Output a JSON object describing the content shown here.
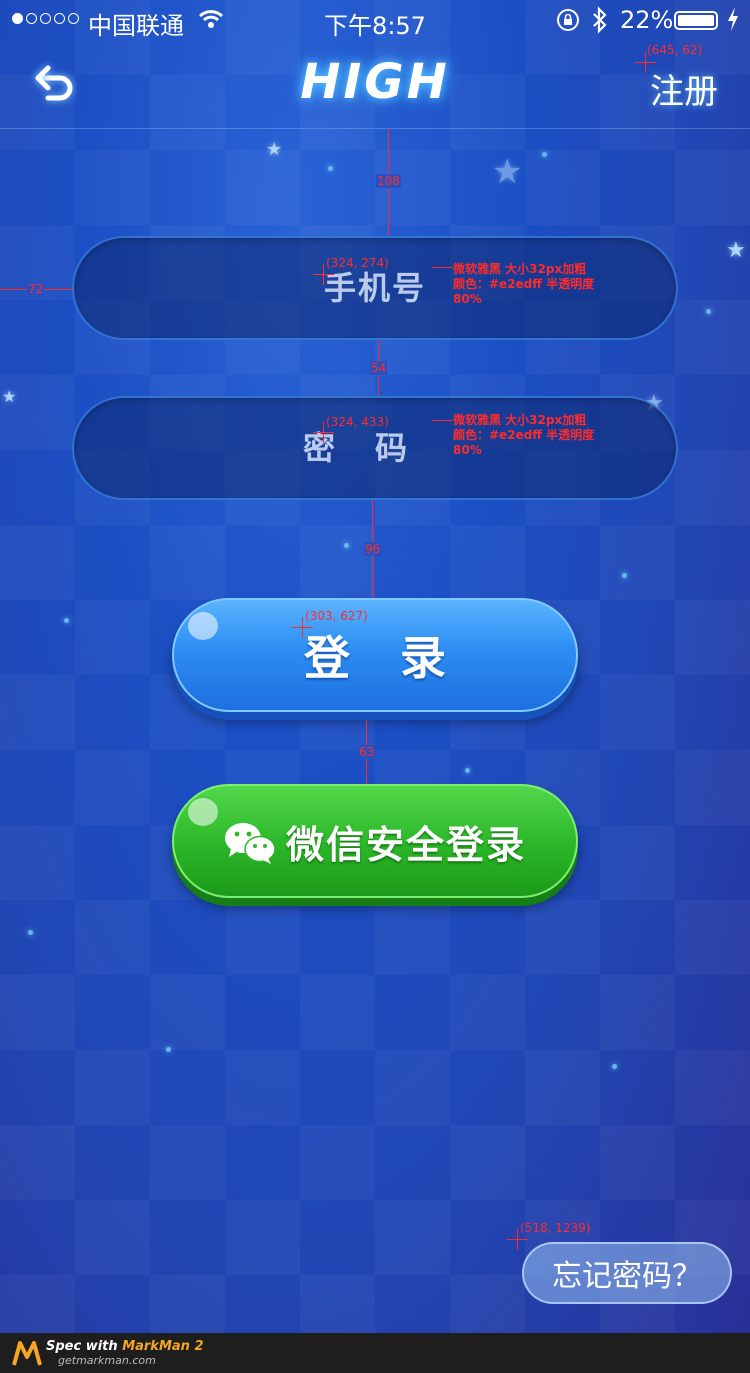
{
  "status_bar": {
    "carrier": "中国联通",
    "time": "下午8:57",
    "battery_pct": "22%",
    "battery_level": 0.22,
    "icons": [
      "signal-dots-icon",
      "wifi-icon",
      "rotation-lock-icon",
      "bluetooth-icon",
      "battery-icon",
      "charging-bolt-icon"
    ]
  },
  "header": {
    "title": "HIGH",
    "register_label": "注册",
    "back_icon": "back-arrow-icon"
  },
  "form": {
    "phone_placeholder": "手机号",
    "password_placeholder": "密码"
  },
  "buttons": {
    "login_label": "登录",
    "wechat_login_label": "微信安全登录",
    "wechat_icon": "wechat-icon",
    "forgot_password_label": "忘记密码？"
  },
  "spec_annotations": {
    "register_coord": "(645, 62)",
    "gap_top": "108",
    "left_margin": "72",
    "phone_coord": "(324, 274)",
    "phone_note_line1": "微软雅黑  大小32px加粗",
    "phone_note_line2": "颜色：#e2edff  半透明度",
    "phone_note_line3": "80%",
    "gap_fields": "54",
    "password_coord": "(324, 433)",
    "password_note_line1": "微软雅黑  大小32px加粗",
    "password_note_line2": "颜色：#e2edff  半透明度",
    "password_note_line3": "80%",
    "gap_login": "96",
    "login_coord": "(303, 627)",
    "gap_wechat": "63",
    "forgot_coord": "(518, 1239)"
  },
  "footer": {
    "brand_prefix": "Spec with ",
    "brand_name": "MarkMan 2",
    "url": "getmarkman.com"
  },
  "colors": {
    "background": "#1c4fc4",
    "login_button": "#2d8df2",
    "wechat_button": "#2db92a",
    "field_text": "#e2edff",
    "spec_red": "#ff2b2b"
  }
}
